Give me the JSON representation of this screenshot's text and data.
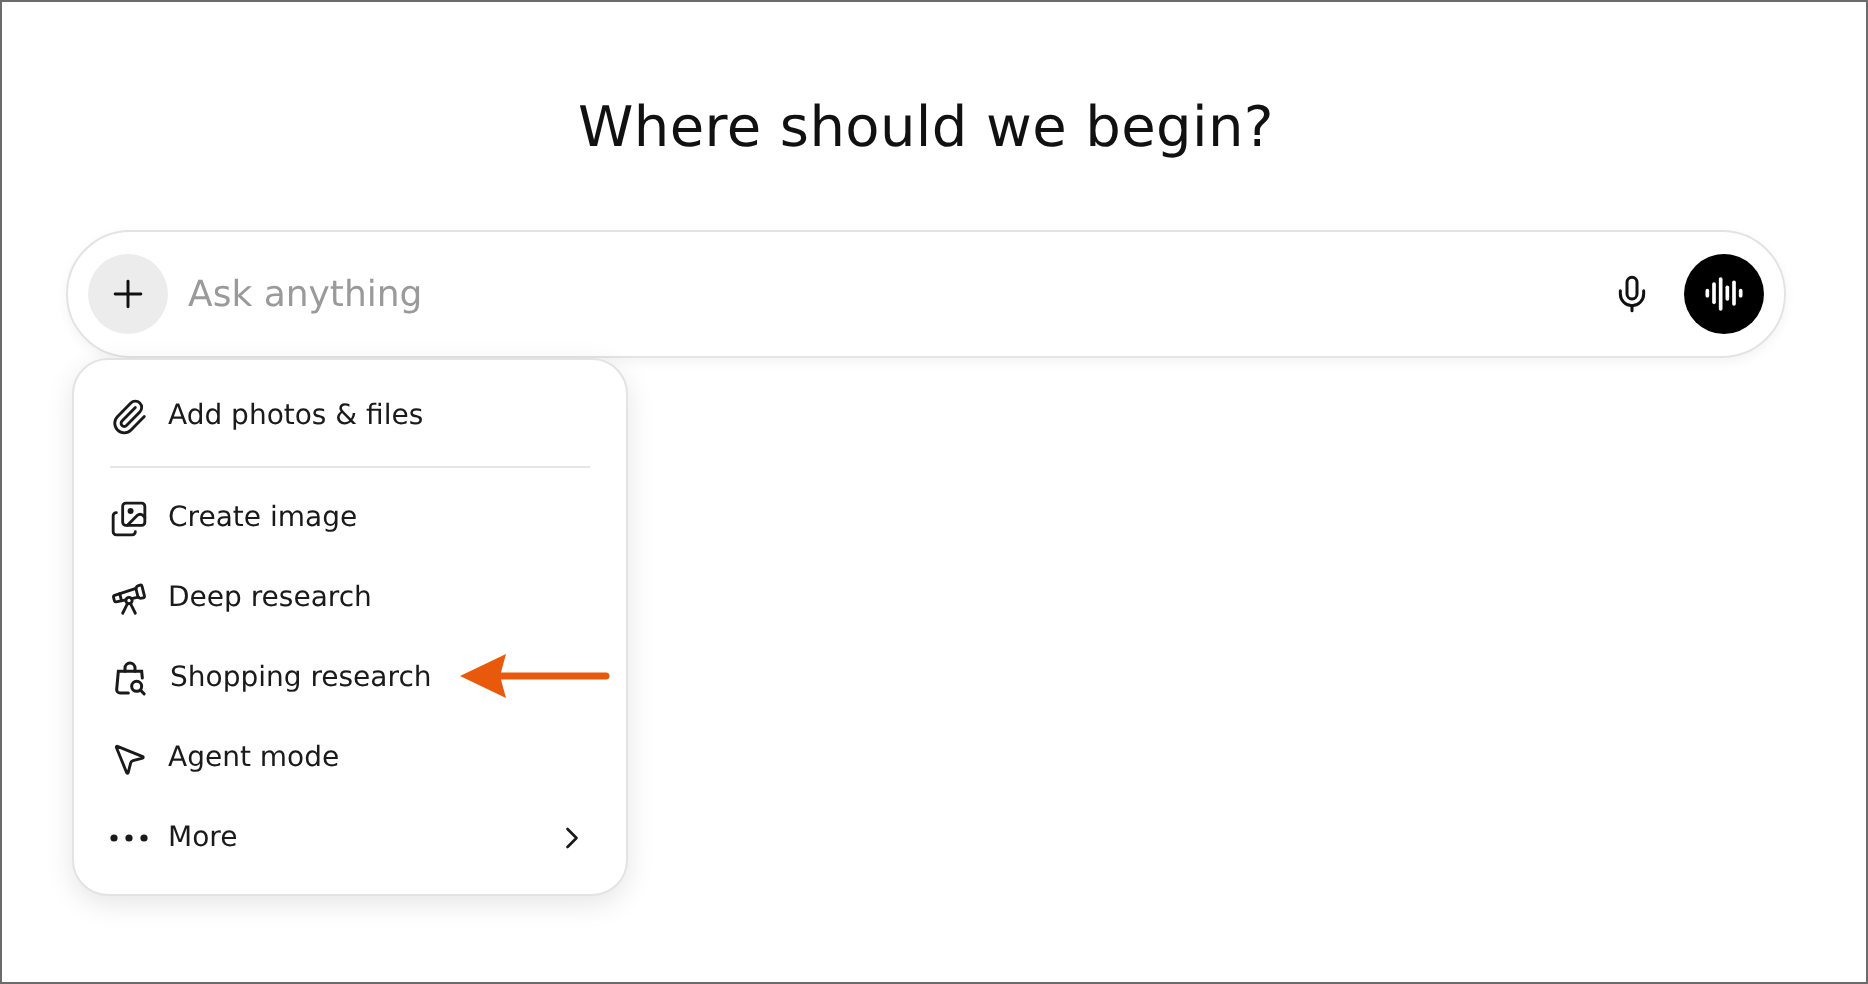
{
  "heading": "Where should we begin?",
  "composer": {
    "placeholder": "Ask anything"
  },
  "attach_menu": {
    "sections": [
      [
        {
          "label": "Add photos & files",
          "kind": "item"
        }
      ],
      [
        {
          "label": "Create image",
          "kind": "item"
        },
        {
          "label": "Deep research",
          "kind": "item"
        },
        {
          "label": "Shopping research",
          "kind": "item"
        },
        {
          "label": "Agent mode",
          "kind": "item"
        },
        {
          "label": "More",
          "kind": "submenu"
        }
      ]
    ]
  }
}
